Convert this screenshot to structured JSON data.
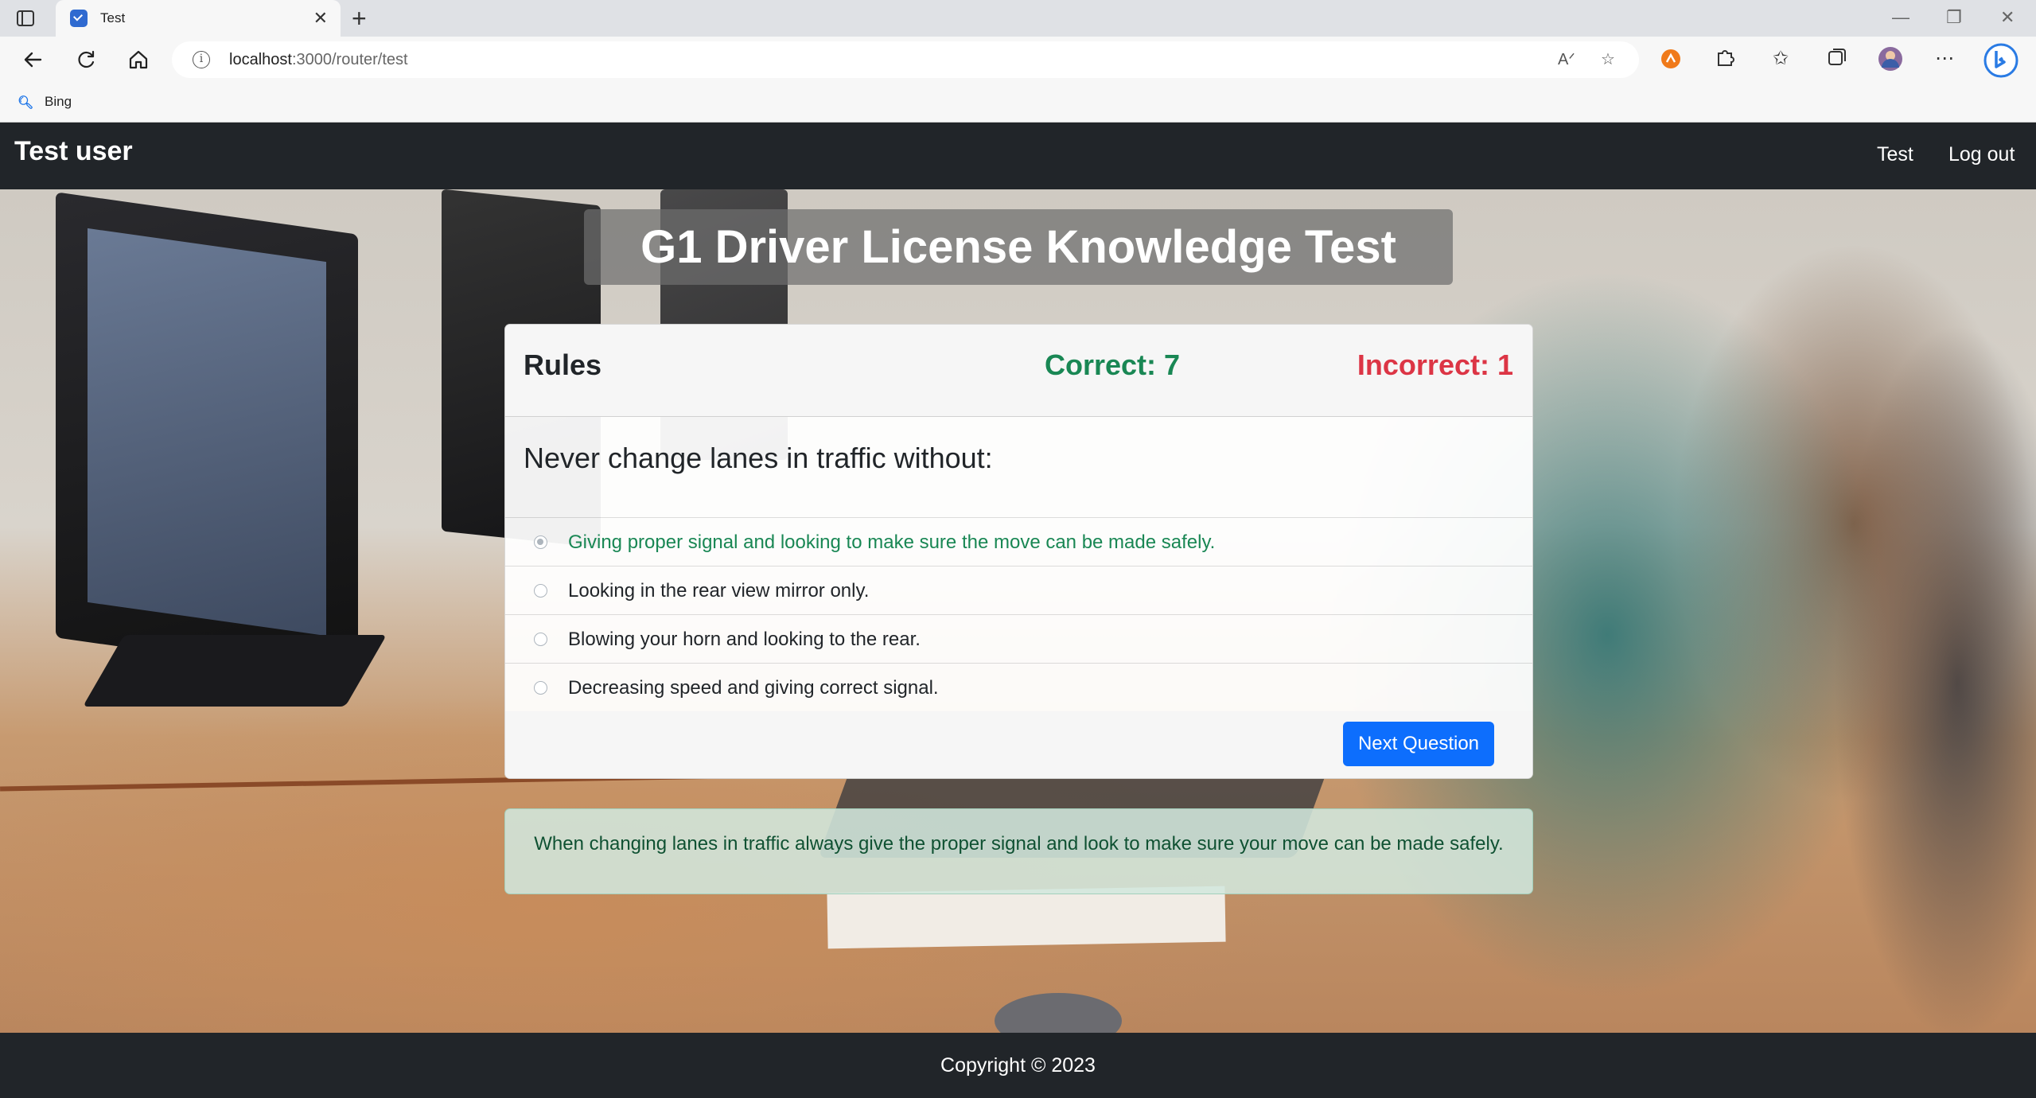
{
  "browser": {
    "tab_title": "Test",
    "tab_close": "✕",
    "new_tab": "+",
    "url_host": "localhost",
    "url_path": ":3000/router/test",
    "favorites": [
      {
        "label": "Bing",
        "icon": "search-icon"
      }
    ],
    "icons": {
      "back": "arrow-left-icon",
      "refresh": "refresh-icon",
      "home": "home-icon",
      "read_aloud": "read-aloud-icon",
      "favorite_add": "star-plus-icon",
      "extension_orange": "extension-icon",
      "extensions": "puzzle-icon",
      "favorites": "favorites-icon",
      "collections": "collections-icon",
      "profile": "avatar",
      "more": "more-icon",
      "copilot": "bing-copilot-icon"
    }
  },
  "navbar": {
    "brand": "Test user",
    "links": [
      "Test",
      "Log out"
    ]
  },
  "page": {
    "title": "G1 Driver License Knowledge Test"
  },
  "quiz": {
    "category": "Rules",
    "correct_label": "Correct: 7",
    "incorrect_label": "Incorrect: 1",
    "correct_count": 7,
    "incorrect_count": 1,
    "question": "Never change lanes in traffic without:",
    "options": [
      {
        "text": "Giving proper signal and looking to make sure the move can be made safely.",
        "selected": true,
        "correct": true
      },
      {
        "text": "Looking in the rear view mirror only.",
        "selected": false,
        "correct": false
      },
      {
        "text": "Blowing your horn and looking to the rear.",
        "selected": false,
        "correct": false
      },
      {
        "text": "Decreasing speed and giving correct signal.",
        "selected": false,
        "correct": false
      }
    ],
    "next_button": "Next Question",
    "explanation": "When changing lanes in traffic always give the proper signal and look to make sure your move can be made safely."
  },
  "footer": {
    "copyright": "Copyright © 2023"
  },
  "colors": {
    "navbar_bg": "#212529",
    "correct": "#198754",
    "incorrect": "#dc3545",
    "primary_button": "#0d6efd",
    "alert_bg": "#d1e7dd",
    "alert_text": "#0f5132"
  }
}
